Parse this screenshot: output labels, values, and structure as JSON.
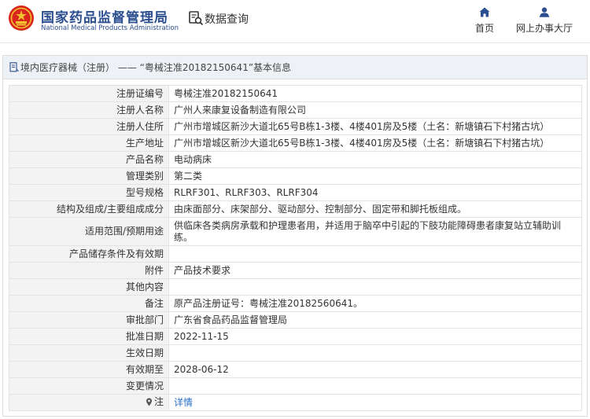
{
  "header": {
    "brand_cn": "国家药品监督管理局",
    "brand_en": "National Medical Products Administration",
    "query_label": "数据查询",
    "nav": [
      {
        "label": "首页",
        "icon": "home-icon"
      },
      {
        "label": "网上办事大厅",
        "icon": "user-icon"
      }
    ]
  },
  "panel": {
    "title": "境内医疗器械（注册） —— “粤械注准20182150641”基本信息"
  },
  "rows": [
    {
      "key": "注册证编号",
      "value": "粤械注准20182150641"
    },
    {
      "key": "注册人名称",
      "value": "广州人来康复设备制造有限公司"
    },
    {
      "key": "注册人住所",
      "value": "广州市增城区新沙大道北65号B栋1-3楼、4楼401房及5楼（土名：新塘镇石下村猪古坑）"
    },
    {
      "key": "生产地址",
      "value": "广州市增城区新沙大道北65号B栋1-3楼、4楼401房及5楼（土名：新塘镇石下村猪古坑）"
    },
    {
      "key": "产品名称",
      "value": "电动病床"
    },
    {
      "key": "管理类别",
      "value": "第二类"
    },
    {
      "key": "型号规格",
      "value": "RLRF301、RLRF303、RLRF304"
    },
    {
      "key": "结构及组成/主要组成成分",
      "value": "由床面部分、床架部分、驱动部分、控制部分、固定带和脚托板组成。"
    },
    {
      "key": "适用范围/预期用途",
      "value": "供临床各类病房承载和护理患者用，并适用于脑卒中引起的下肢功能障碍患者康复站立辅助训练。"
    },
    {
      "key": "产品储存条件及有效期",
      "value": ""
    },
    {
      "key": "附件",
      "value": "产品技术要求"
    },
    {
      "key": "其他内容",
      "value": ""
    },
    {
      "key": "备注",
      "value": "原产品注册证号：粤械注准20182560641。"
    },
    {
      "key": "审批部门",
      "value": "广东省食品药品监督管理局"
    },
    {
      "key": "批准日期",
      "value": "2022-11-15"
    },
    {
      "key": "生效日期",
      "value": ""
    },
    {
      "key": "有效期至",
      "value": "2028-06-12"
    },
    {
      "key": "变更情况",
      "value": ""
    }
  ],
  "note_row": {
    "key": "注",
    "link_label": "详情"
  },
  "colors": {
    "brand_blue": "#2c4f8f",
    "link_blue": "#2a6fc9",
    "logo_red": "#d9261c",
    "logo_gold": "#f2c230"
  }
}
